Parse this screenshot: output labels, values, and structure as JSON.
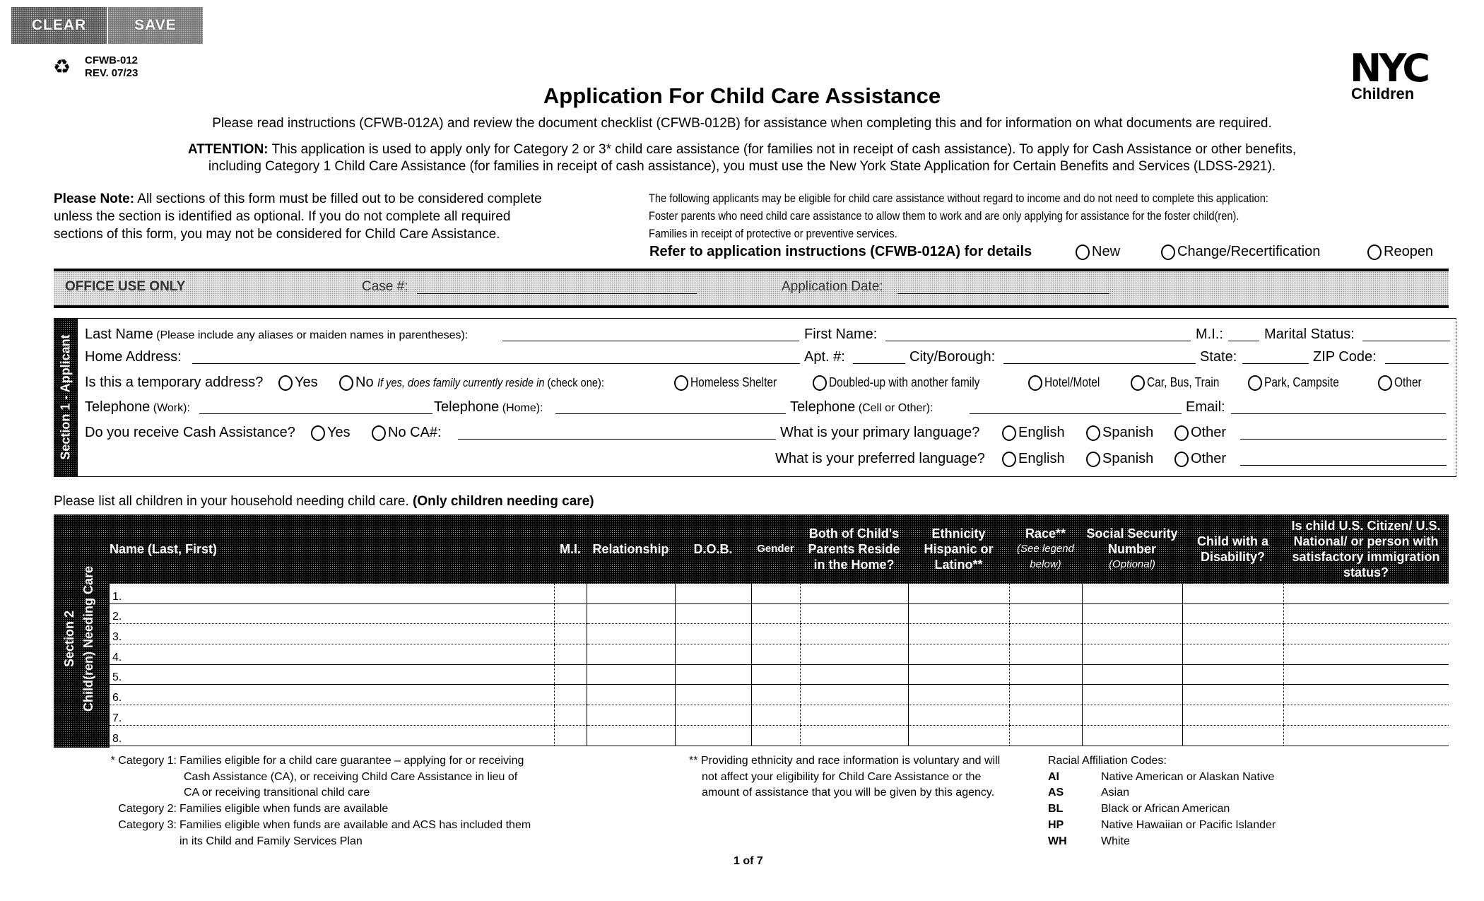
{
  "toolbar": {
    "clear_label": "CLEAR",
    "save_label": "SAVE"
  },
  "header": {
    "form_number": "CFWB-012",
    "revision": "REV. 07/23",
    "title": "Application For Child Care Assistance",
    "logo_top": "NYC",
    "logo_bottom": "Children",
    "instructions": "Please read instructions (CFWB-012A) and review the document checklist (CFWB-012B) for assistance when completing this and for information on what documents are required.",
    "attention_label": "ATTENTION:",
    "attention_line1": " This application is used to apply only for Category 2 or 3* child care assistance (for families not in receipt of cash assistance). To apply for Cash Assistance or other benefits,",
    "attention_line2": "including Category 1 Child Care Assistance (for families in receipt of cash assistance), you must use the New York State Application for Certain Benefits and Services (LDSS-2921)."
  },
  "note": {
    "label": "Please Note:",
    "line1": " All sections of this form must be filled out to be considered complete",
    "line2": "unless the section is identified as optional. If you do not complete all required",
    "line3": "sections of this form, you may not be considered for Child Care Assistance."
  },
  "eligibility": {
    "line1": "The following applicants may be eligible for child care assistance without regard to income and do not need to complete this application:",
    "line2": "Foster parents who need child care assistance to allow them to work and are only applying for assistance for the foster child(ren).",
    "line3": "Families in receipt of protective or preventive services.",
    "refer": "Refer to application instructions (CFWB-012A) for details",
    "options": [
      "New",
      "Change/Recertification",
      "Reopen"
    ]
  },
  "office": {
    "label": "OFFICE USE ONLY",
    "case_label": "Case #:",
    "date_label": "Application Date:"
  },
  "section1": {
    "label": "Section 1 - Applicant",
    "last_name_label": "Last Name",
    "last_name_hint": " (Please include any aliases or maiden names in parentheses):",
    "first_name_label": "First Name:",
    "mi_label": "M.I.:",
    "marital_label": "Marital Status:",
    "address_label": "Home Address:",
    "apt_label": "Apt. #:",
    "city_label": "City/Borough:",
    "state_label": "State:",
    "zip_label": "ZIP Code:",
    "temp_question": "Is this a temporary address?",
    "yes": "Yes",
    "no": "No",
    "temp_followup": "If yes, does family currently reside in",
    "check_one": " (check one):",
    "residences": [
      "Homeless Shelter",
      "Doubled-up with another family",
      "Hotel/Motel",
      "Car, Bus, Train",
      "Park, Campsite",
      "Other"
    ],
    "tel_work_label": "Telephone",
    "tel_work_hint": " (Work):",
    "tel_home_label": "Telephone",
    "tel_home_hint": " (Home):",
    "tel_cell_label": "Telephone",
    "tel_cell_hint": " (Cell or Other):",
    "email_label": "Email:",
    "cash_question": "Do you receive Cash Assistance?",
    "ca_label": "CA#:",
    "primary_lang_question": "What is your primary language?",
    "preferred_lang_question": "What is your preferred language?",
    "languages": [
      "English",
      "Spanish",
      "Other"
    ]
  },
  "section2": {
    "intro": "Please list all children in your household needing child care. ",
    "intro_bold": "(Only children needing care)",
    "label_line1": "Section 2",
    "label_line2": "Child(ren) Needing Care",
    "columns": [
      {
        "title": "Name (Last, First)"
      },
      {
        "title": "M.I."
      },
      {
        "title": "Relationship"
      },
      {
        "title": "D.O.B."
      },
      {
        "title": "Gender"
      },
      {
        "title": "Both of Child's Parents Reside in the Home?"
      },
      {
        "title": "Ethnicity Hispanic or Latino**"
      },
      {
        "title": "Race**",
        "note": "(See legend below)"
      },
      {
        "title": "Social Security Number",
        "note": "(Optional)"
      },
      {
        "title": "Child with a Disability?"
      },
      {
        "title": "Is child U.S. Citizen/ U.S. National/ or person with satisfactory immigration status?"
      }
    ],
    "rows": [
      "1.",
      "2.",
      "3.",
      "4.",
      "5.",
      "6.",
      "7.",
      "8."
    ]
  },
  "footnotes": {
    "categories": [
      {
        "prefix": "* Category 1:",
        "text": [
          "Families eligible for a child care guarantee – applying for or receiving",
          "Cash Assistance (CA), or receiving Child Care Assistance in lieu of",
          "CA or receiving transitional child care"
        ]
      },
      {
        "prefix": "Category 2:",
        "text": [
          "Families eligible when funds are available"
        ]
      },
      {
        "prefix": "Category 3:",
        "text": [
          "Families eligible when funds are available and ACS has included them",
          "in its Child and Family Services Plan"
        ]
      }
    ],
    "ethnicity_note": [
      "** Providing ethnicity and race information is voluntary and will",
      "not affect your eligibility for Child Care Assistance or the",
      "amount of assistance that you will be given by this agency."
    ],
    "race_title": "Racial Affiliation Codes:",
    "race_codes": [
      {
        "code": "AI",
        "label": "Native American or Alaskan Native"
      },
      {
        "code": "AS",
        "label": "Asian"
      },
      {
        "code": "BL",
        "label": "Black or African American"
      },
      {
        "code": "HP",
        "label": "Native Hawaiian or Pacific Islander"
      },
      {
        "code": "WH",
        "label": "White"
      }
    ],
    "page": "1 of 7"
  }
}
